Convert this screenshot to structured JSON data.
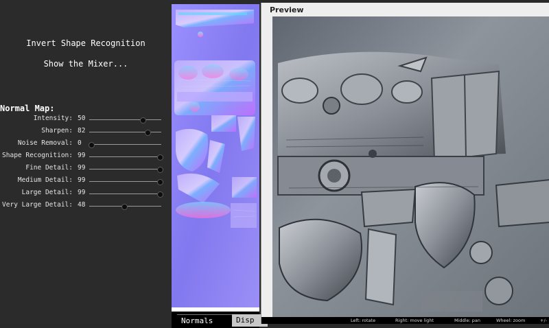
{
  "menu": {
    "invert_shape": "Invert Shape Recognition",
    "show_mixer": "Show the Mixer..."
  },
  "normal_map": {
    "title": "Normal Map:",
    "params": [
      {
        "label": "Intensity:",
        "value": 50,
        "fraction": 0.73
      },
      {
        "label": "Sharpen:",
        "value": 82,
        "fraction": 0.8
      },
      {
        "label": "Noise Removal:",
        "value": 0,
        "fraction": 0.02
      },
      {
        "label": "Shape Recognition:",
        "value": 99,
        "fraction": 0.97
      },
      {
        "label": "Fine Detail:",
        "value": 99,
        "fraction": 0.97
      },
      {
        "label": "Medium Detail:",
        "value": 99,
        "fraction": 0.97
      },
      {
        "label": "Large Detail:",
        "value": 99,
        "fraction": 0.97
      },
      {
        "label": "Very Large Detail:",
        "value": 48,
        "fraction": 0.48
      }
    ]
  },
  "tabs": {
    "normals": "Normals",
    "disp": "Disp"
  },
  "preview": {
    "title": "Preview",
    "hints": {
      "left": "Left: rotate",
      "right": "Right: move light",
      "middle": "Middle: pan",
      "wheel": "Wheel: zoom",
      "plusminus": "+/-"
    }
  },
  "colors": {
    "panel_bg": "#2b2b2b",
    "normal_map_base": "#8a80f0",
    "preview_stone": "#8c929a"
  }
}
